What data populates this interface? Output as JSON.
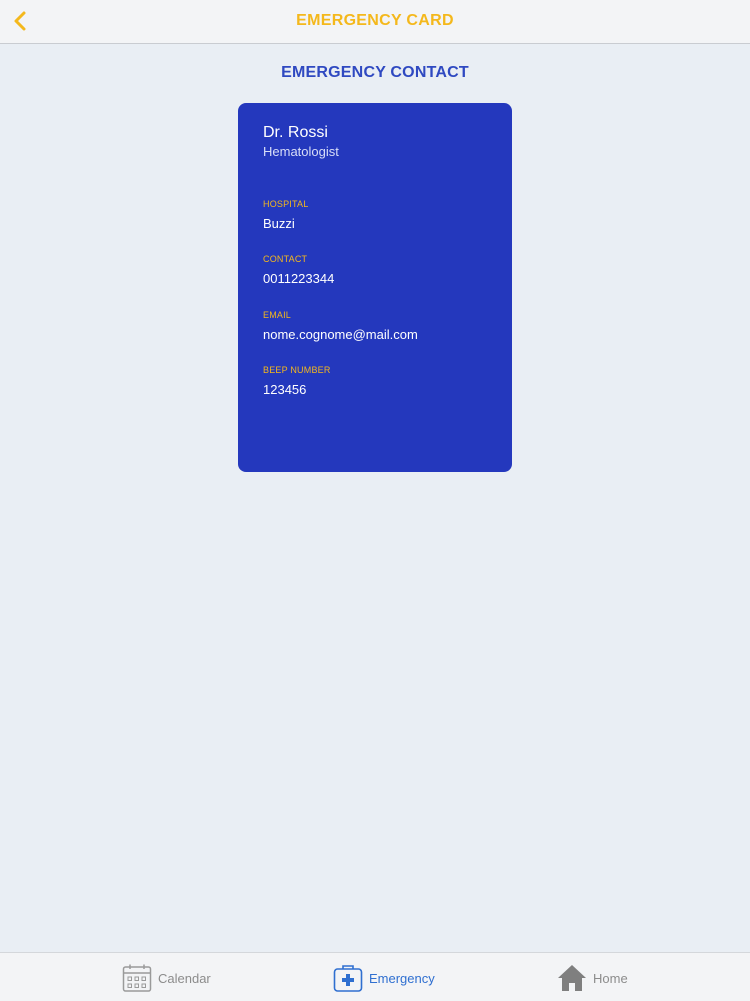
{
  "header": {
    "title": "EMERGENCY CARD",
    "back_icon": "chevron-left-icon"
  },
  "section": {
    "title": "EMERGENCY CONTACT"
  },
  "card": {
    "name": "Dr. Rossi",
    "role": "Hematologist",
    "fields": [
      {
        "label": "HOSPITAL",
        "value": "Buzzi"
      },
      {
        "label": "CONTACT",
        "value": "0011223344"
      },
      {
        "label": "EMAIL",
        "value": "nome.cognome@mail.com"
      },
      {
        "label": "BEEP NUMBER",
        "value": "123456"
      }
    ]
  },
  "tabbar": {
    "tabs": [
      {
        "label": "Calendar",
        "icon": "calendar-icon",
        "active": false
      },
      {
        "label": "Emergency",
        "icon": "medical-kit-icon",
        "active": true
      },
      {
        "label": "Home",
        "icon": "home-icon",
        "active": false
      }
    ]
  },
  "colors": {
    "accent": "#f4b81c",
    "card": "#2438bd",
    "section_title": "#2f49c1",
    "active_tab": "#2f6fd0",
    "inactive_tab": "#8c8c8c"
  }
}
